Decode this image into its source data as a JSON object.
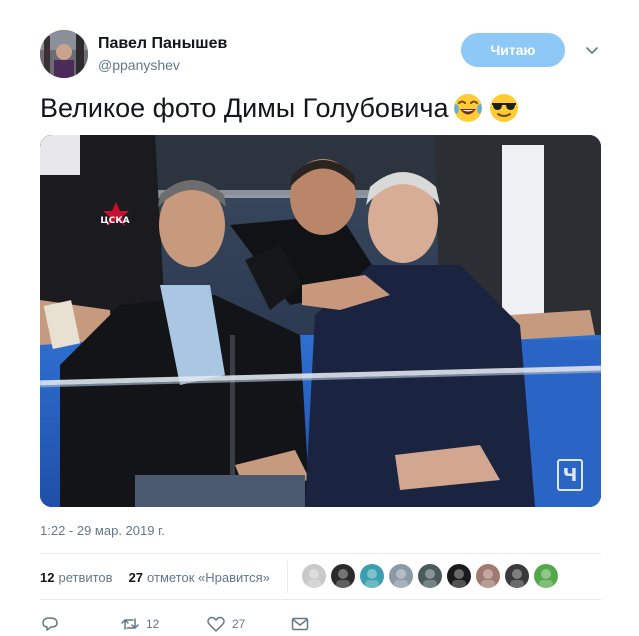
{
  "author": {
    "name": "Павел Панышев",
    "handle": "@ppanyshev",
    "avatar_icon": "profile-photo"
  },
  "follow_button": {
    "label": "Читаю",
    "color": "#8dc8f6"
  },
  "tweet": {
    "text": "Великое фото Димы Голубовича",
    "emojis": [
      "face-with-tears-of-joy-emoji",
      "smiling-face-with-sunglasses-emoji"
    ],
    "photo": {
      "type": "photograph",
      "subject": "three men seated in a hockey arena VIP box",
      "badge": "Ч",
      "jersey_text": "ЦСКА"
    },
    "timestamp": "1:22 - 29 мар. 2019 г."
  },
  "stats": {
    "retweets_count": "12",
    "retweets_label": "ретвитов",
    "likes_count": "27",
    "likes_label": "отметок «Нравится»"
  },
  "likers": [
    {
      "icon": "liker-avatar",
      "color": "#c9c9c9"
    },
    {
      "icon": "liker-avatar",
      "color": "#2a2a2a"
    },
    {
      "icon": "liker-avatar",
      "color": "#3a9fb0"
    },
    {
      "icon": "liker-avatar",
      "color": "#8a9aa6"
    },
    {
      "icon": "liker-avatar",
      "color": "#4a5a5a"
    },
    {
      "icon": "liker-avatar",
      "color": "#1a1a1a"
    },
    {
      "icon": "liker-avatar",
      "color": "#a07a70"
    },
    {
      "icon": "liker-avatar",
      "color": "#3a3a3a"
    },
    {
      "icon": "liker-avatar",
      "color": "#55a84a"
    }
  ],
  "actions": {
    "reply_icon": "reply-icon",
    "retweet_icon": "retweet-icon",
    "retweet_count": "12",
    "like_icon": "heart-icon",
    "like_count": "27",
    "message_icon": "direct-message-icon"
  },
  "colors": {
    "text_primary": "#14171a",
    "text_secondary": "#657786",
    "divider": "#e6ecf0"
  }
}
